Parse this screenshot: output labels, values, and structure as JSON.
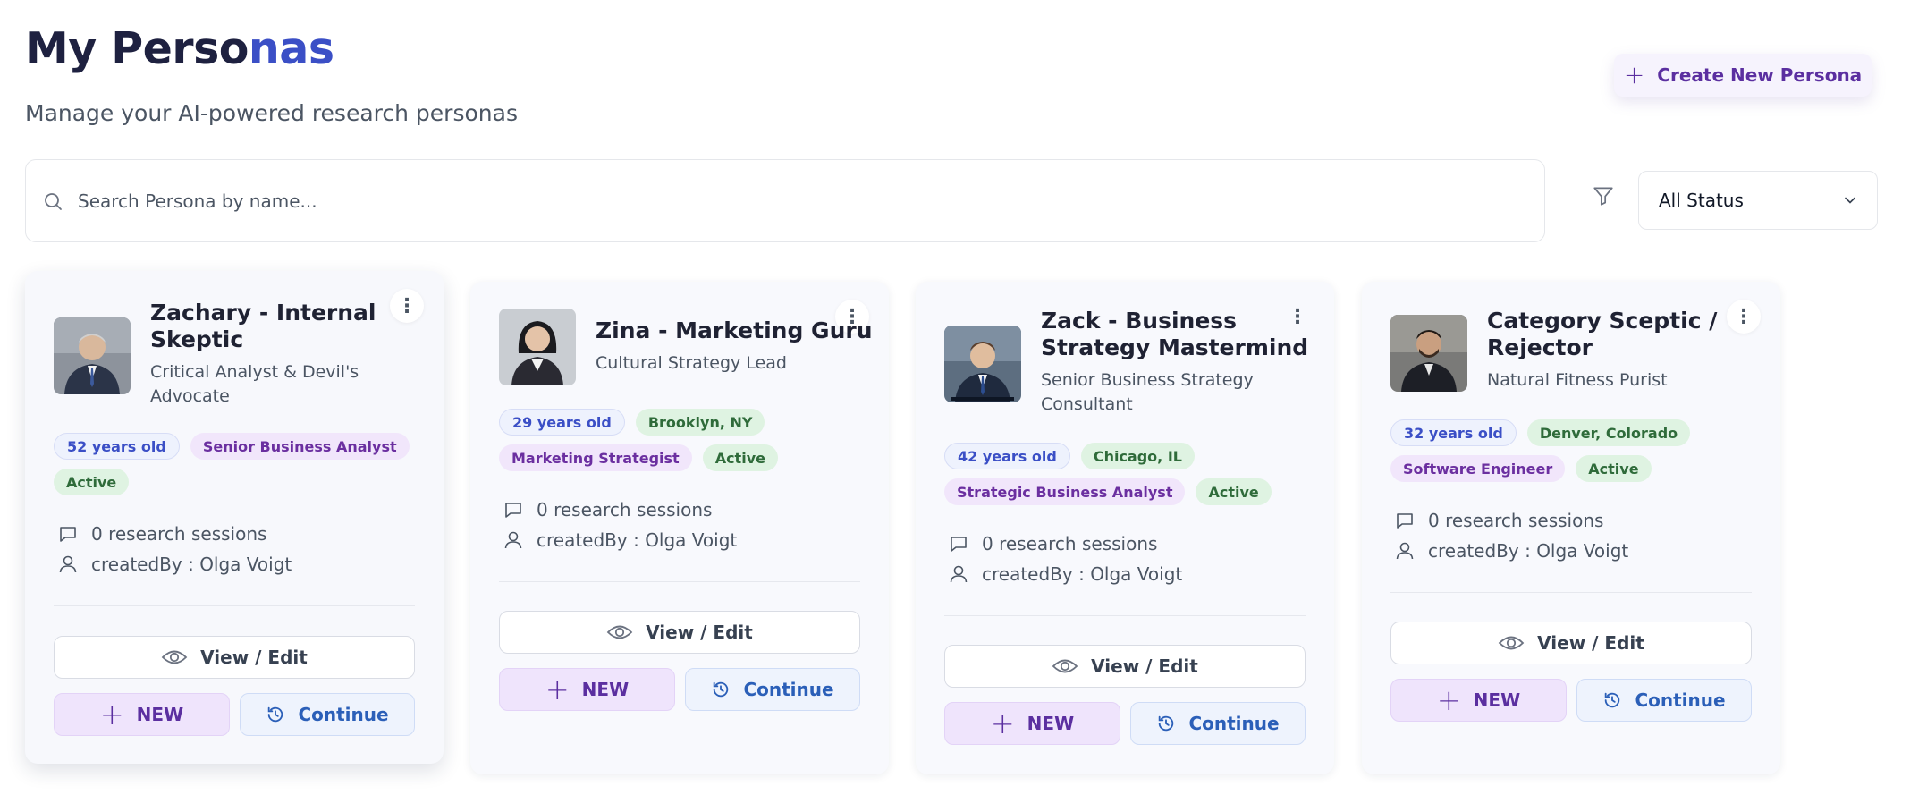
{
  "header": {
    "title_main": "My Perso",
    "title_accent": "nas",
    "subtitle": "Manage your AI-powered research personas",
    "create_label": "Create New Persona"
  },
  "search": {
    "placeholder": "Search Persona by name..."
  },
  "filter": {
    "status_value": "All Status"
  },
  "buttons": {
    "view_edit": "View / Edit",
    "new": "NEW",
    "continue": "Continue"
  },
  "personas": [
    {
      "name": "Zachary - Internal Skeptic",
      "role": "Critical Analyst & Devil's Advocate",
      "age": "52 years old",
      "location": "",
      "job": "Senior Business Analyst",
      "status": "Active",
      "sessions": "0 research sessions",
      "created_by": "createdBy : Olga Voigt"
    },
    {
      "name": "Zina - Marketing Guru",
      "role": "Cultural Strategy Lead",
      "age": "29 years old",
      "location": "Brooklyn, NY",
      "job": "Marketing Strategist",
      "status": "Active",
      "sessions": "0 research sessions",
      "created_by": "createdBy : Olga Voigt"
    },
    {
      "name": "Zack - Business Strategy Mastermind",
      "role": "Senior Business Strategy Consultant",
      "age": "42 years old",
      "location": "Chicago, IL",
      "job": "Strategic Business Analyst",
      "status": "Active",
      "sessions": "0 research sessions",
      "created_by": "createdBy : Olga Voigt"
    },
    {
      "name": "Category Sceptic / Rejector",
      "role": "Natural Fitness Purist",
      "age": "32 years old",
      "location": "Denver, Colorado",
      "job": "Software Engineer",
      "status": "Active",
      "sessions": "0 research sessions",
      "created_by": "createdBy : Olga Voigt"
    }
  ],
  "colors": {
    "accent": "#3b4fc6",
    "purple": "#5b2fa0",
    "green_tag": "#dff3e2",
    "blue_button": "#2b5fb8"
  }
}
